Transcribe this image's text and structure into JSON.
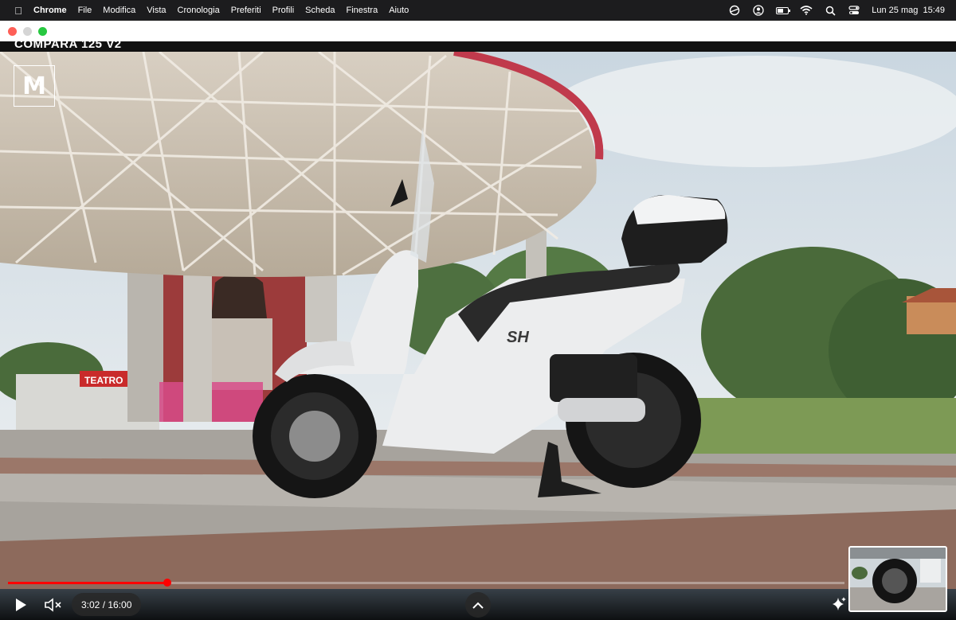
{
  "menubar": {
    "app_name": "Chrome",
    "items": [
      "File",
      "Modifica",
      "Vista",
      "Cronologia",
      "Preferiti",
      "Profili",
      "Scheda",
      "Finestra",
      "Aiuto"
    ],
    "clock": "Lun 25 mag  15:49"
  },
  "video": {
    "title": "COMPARA 125 V2",
    "channel_logo": "M",
    "sign_text": "TEATRO",
    "scooter_badge": "SH"
  },
  "player": {
    "time": "3:02 / 16:00",
    "progress": 0.19
  },
  "colors": {
    "progress": "#ff0000",
    "menubar": "#1c1c1e",
    "close": "#fe5f57",
    "maximize": "#27c840"
  },
  "icons": {
    "play": "play-icon",
    "mute": "muted-speaker-icon",
    "chevron": "chevron-up-icon",
    "sparkle": "sparkle-icon"
  }
}
